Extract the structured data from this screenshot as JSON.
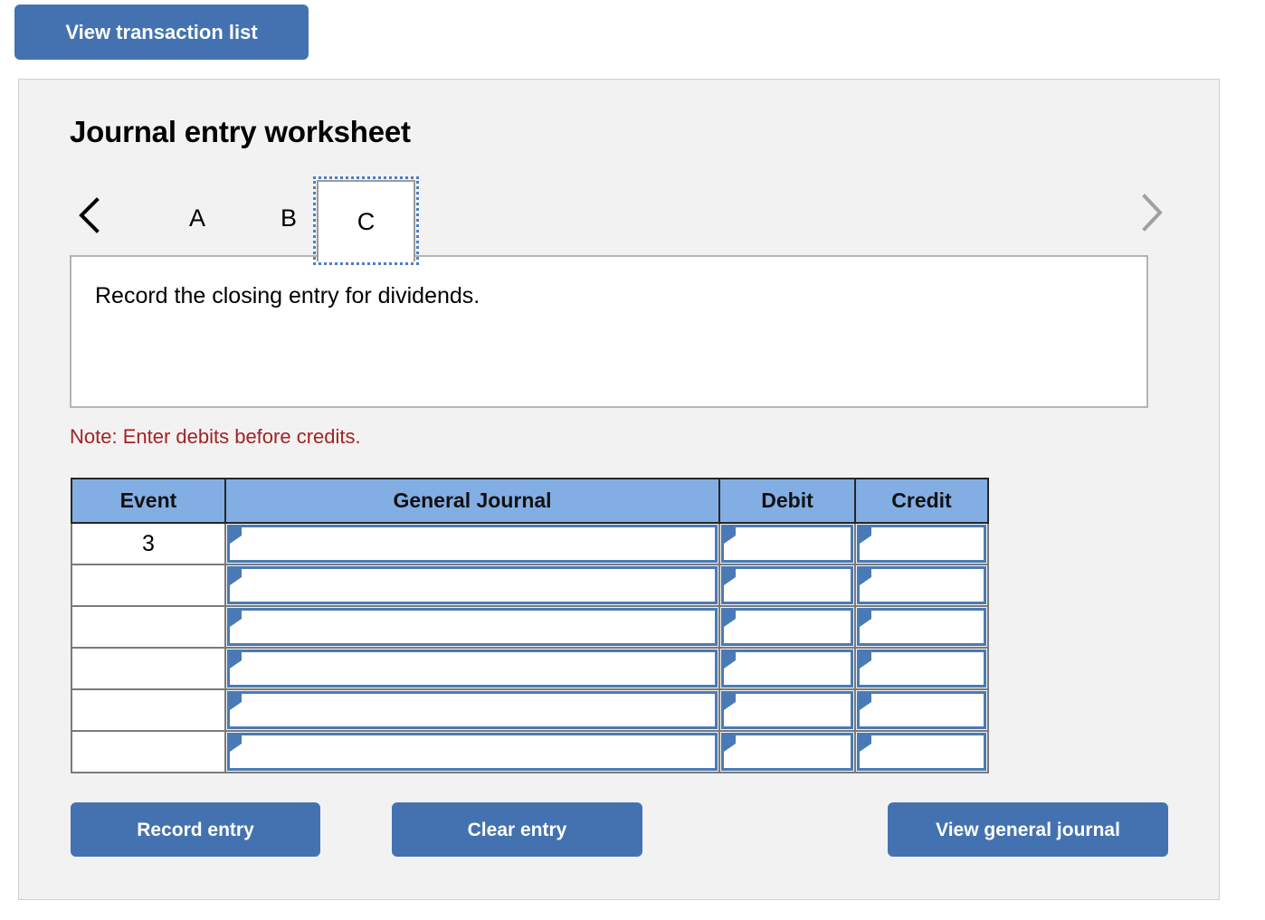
{
  "toolbar": {
    "view_transaction_list_label": "View transaction list"
  },
  "card": {
    "title": "Journal entry worksheet"
  },
  "tabs": {
    "prev_icon": "chevron-left-icon",
    "next_icon": "chevron-right-icon",
    "items": [
      {
        "label": "A",
        "active": false
      },
      {
        "label": "B",
        "active": false
      },
      {
        "label": "C",
        "active": true
      }
    ],
    "active_label": "C"
  },
  "instruction": {
    "text": "Record the closing entry for dividends."
  },
  "note": {
    "text": "Note: Enter debits before credits.",
    "color": "#a32323"
  },
  "journal_table": {
    "columns": [
      "Event",
      "General Journal",
      "Debit",
      "Credit"
    ],
    "rows": [
      {
        "event": "3",
        "general_journal": "",
        "debit": "",
        "credit": ""
      },
      {
        "event": "",
        "general_journal": "",
        "debit": "",
        "credit": ""
      },
      {
        "event": "",
        "general_journal": "",
        "debit": "",
        "credit": ""
      },
      {
        "event": "",
        "general_journal": "",
        "debit": "",
        "credit": ""
      },
      {
        "event": "",
        "general_journal": "",
        "debit": "",
        "credit": ""
      },
      {
        "event": "",
        "general_journal": "",
        "debit": "",
        "credit": ""
      }
    ]
  },
  "actions": {
    "record_entry_label": "Record entry",
    "clear_entry_label": "Clear entry",
    "view_general_journal_label": "View general journal"
  },
  "colors": {
    "button_blue": "#4472b0",
    "header_blue": "#82aee3",
    "cell_border_blue": "#4a7ab5",
    "focus_outline_blue": "#4b7fc4",
    "card_background": "#f2f2f2",
    "note_red": "#a32323"
  }
}
